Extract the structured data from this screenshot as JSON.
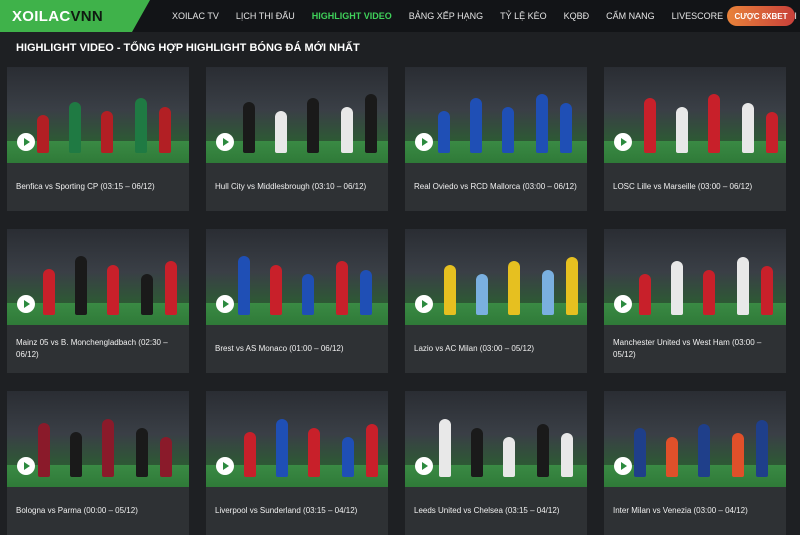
{
  "header": {
    "logo_part1": "XOILAC",
    "logo_part2": "VNN",
    "nav": [
      {
        "label": "XOILAC TV"
      },
      {
        "label": "LỊCH THI ĐẤU"
      },
      {
        "label": "HIGHLIGHT VIDEO",
        "active": true
      },
      {
        "label": "BẢNG XẾP HẠNG"
      },
      {
        "label": "TỶ LỆ KÈO"
      },
      {
        "label": "KQBĐ"
      },
      {
        "label": "CẨM NANG"
      },
      {
        "label": "LIVESCORE"
      },
      {
        "label": "TIN TỨC MỚI"
      }
    ],
    "bet_button": "CƯỢC 8XBET"
  },
  "page_title": "HIGHLIGHT VIDEO - TỔNG HỢP HIGHLIGHT BÓNG ĐÁ MỚI NHẤT",
  "videos": [
    {
      "title": "Benfica vs Sporting CP (03:15 – 06/12)",
      "colors": [
        "#b21f24",
        "#1f7a43"
      ]
    },
    {
      "title": "Hull City vs Middlesbrough (03:10 – 06/12)",
      "colors": [
        "#1a1a1a",
        "#e8e8e8"
      ]
    },
    {
      "title": "Real Oviedo vs RCD Mallorca (03:00 – 06/12)",
      "colors": [
        "#1f4fb5",
        "#1f4fb5"
      ]
    },
    {
      "title": "LOSC Lille vs Marseille (03:00 – 06/12)",
      "colors": [
        "#c8202a",
        "#e8e8e8"
      ]
    },
    {
      "title": "Mainz 05 vs B. Monchengladbach (02:30 – 06/12)",
      "colors": [
        "#c8202a",
        "#1a1a1a"
      ]
    },
    {
      "title": "Brest vs AS Monaco (01:00 – 06/12)",
      "colors": [
        "#1f4fb5",
        "#c8202a"
      ]
    },
    {
      "title": "Lazio vs AC Milan (03:00 – 05/12)",
      "colors": [
        "#e6c020",
        "#7ab0e0"
      ]
    },
    {
      "title": "Manchester United vs West Ham (03:00 – 05/12)",
      "colors": [
        "#c8202a",
        "#e8e8e8"
      ]
    },
    {
      "title": "Bologna vs Parma (00:00 – 05/12)",
      "colors": [
        "#8a1a2a",
        "#1a1a1a"
      ]
    },
    {
      "title": "Liverpool vs Sunderland (03:15 – 04/12)",
      "colors": [
        "#c8202a",
        "#1f4fb5"
      ]
    },
    {
      "title": "Leeds United vs Chelsea (03:15 – 04/12)",
      "colors": [
        "#e8e8e8",
        "#1a1a1a"
      ]
    },
    {
      "title": "Inter Milan vs Venezia (03:00 – 04/12)",
      "colors": [
        "#1f3f8a",
        "#e0502a"
      ]
    }
  ]
}
